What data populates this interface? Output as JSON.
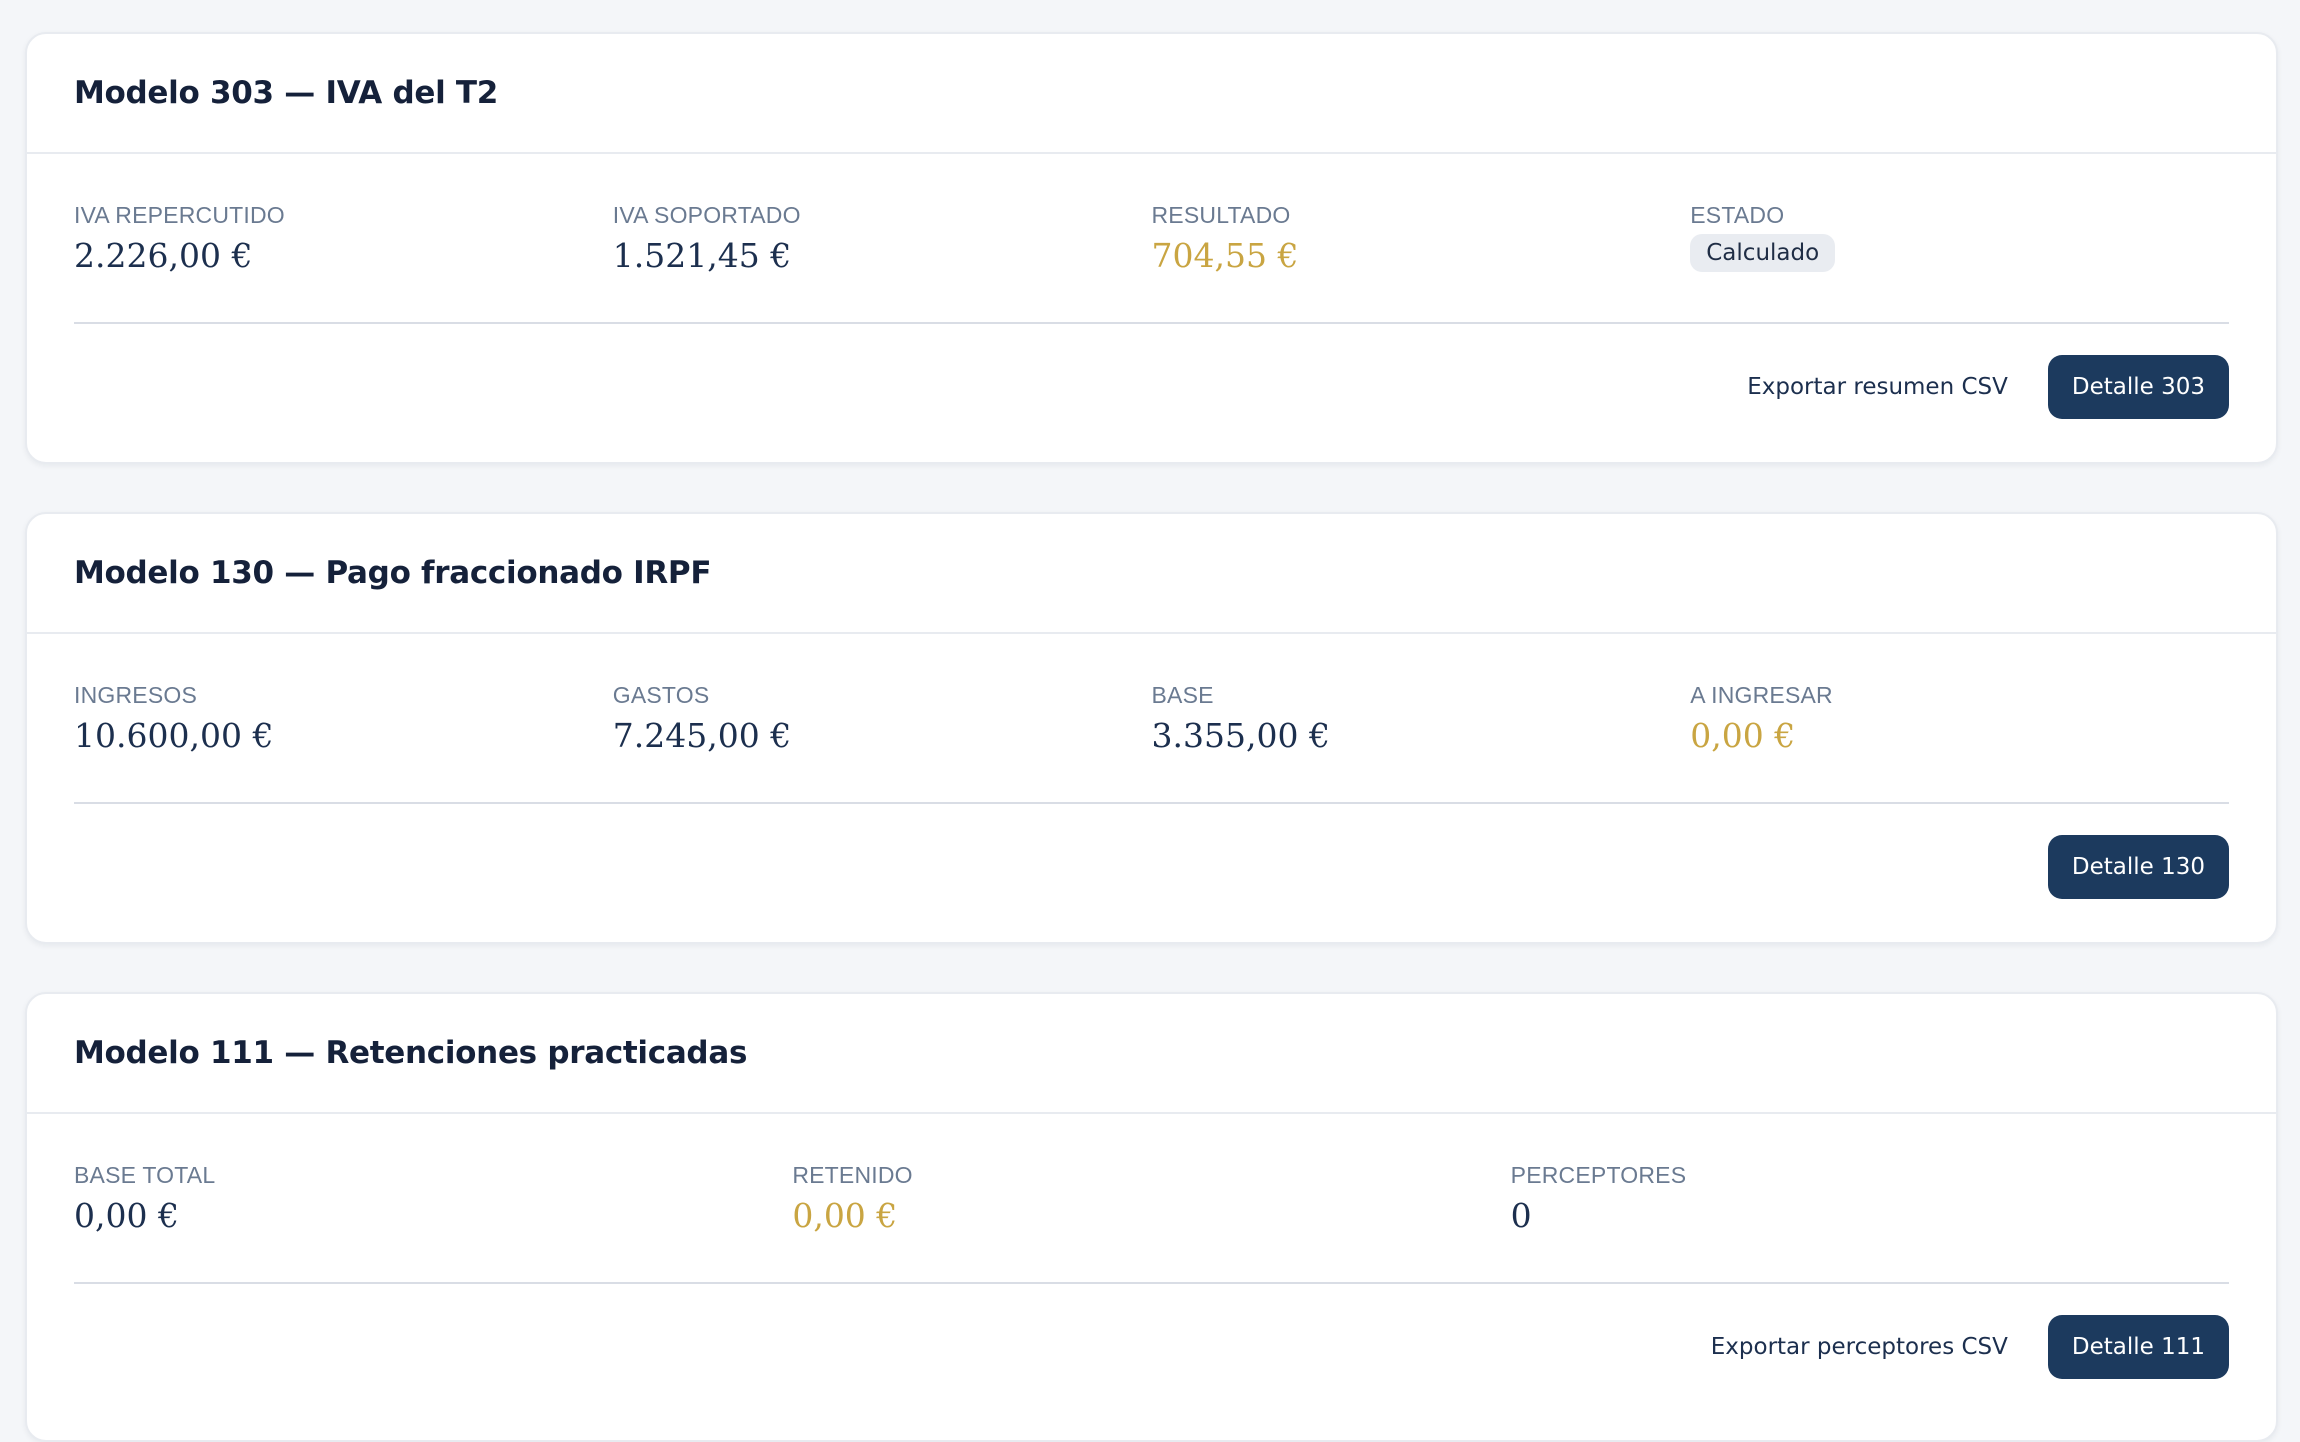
{
  "cards": [
    {
      "title": "Modelo 303 — IVA del T2",
      "metrics": [
        {
          "label": "IVA REPERCUTIDO",
          "value": "2.226,00 €"
        },
        {
          "label": "IVA SOPORTADO",
          "value": "1.521,45 €"
        },
        {
          "label": "RESULTADO",
          "value": "704,55 €"
        },
        {
          "label": "ESTADO",
          "badge": "Calculado"
        }
      ],
      "secondary_action": "Exportar resumen CSV",
      "primary_action": "Detalle 303"
    },
    {
      "title": "Modelo 130 — Pago fraccionado IRPF",
      "metrics": [
        {
          "label": "INGRESOS",
          "value": "10.600,00 €"
        },
        {
          "label": "GASTOS",
          "value": "7.245,00 €"
        },
        {
          "label": "BASE",
          "value": "3.355,00 €"
        },
        {
          "label": "A INGRESAR",
          "value": "0,00 €"
        }
      ],
      "primary_action": "Detalle 130"
    },
    {
      "title": "Modelo 111 — Retenciones practicadas",
      "metrics": [
        {
          "label": "BASE TOTAL",
          "value": "0,00 €"
        },
        {
          "label": "RETENIDO",
          "value": "0,00 €"
        },
        {
          "label": "PERCEPTORES",
          "value": "0"
        }
      ],
      "secondary_action": "Exportar perceptores CSV",
      "primary_action": "Detalle 111"
    }
  ],
  "colors": {
    "accent_gold": "#c9a542",
    "primary_navy": "#1c3a5e",
    "label_gray": "#6a7a91"
  }
}
